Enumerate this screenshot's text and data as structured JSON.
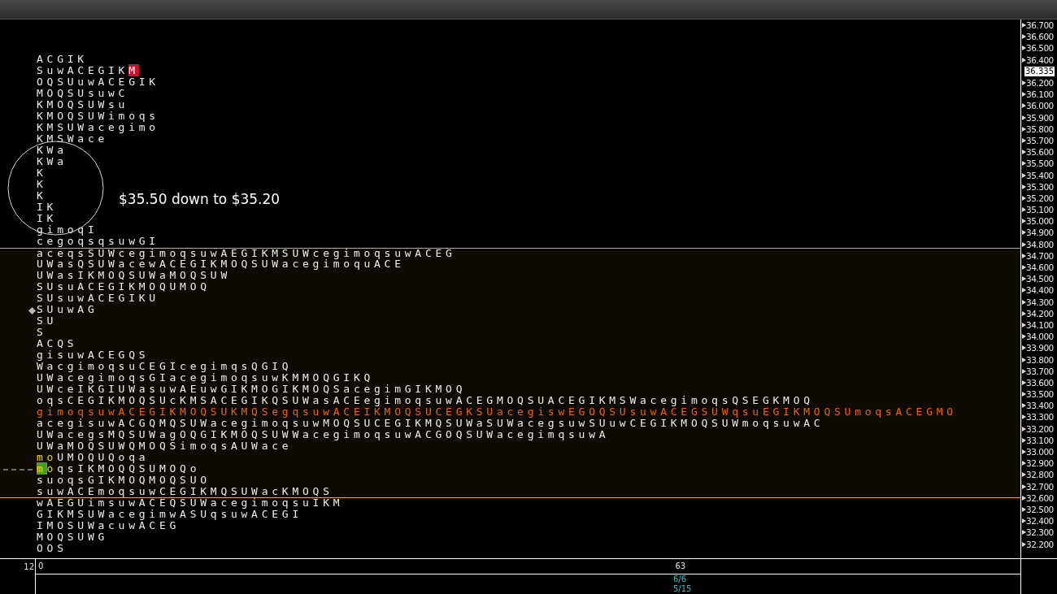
{
  "annotation": {
    "text": "$35.50 down to $35.20"
  },
  "rows": [
    {
      "in_value_area": false,
      "kind": "plain",
      "parts": [
        {
          "text": "ACGIK",
          "kind": "normal"
        }
      ]
    },
    {
      "in_value_area": false,
      "kind": "plain",
      "parts": [
        {
          "text": "SuwACEGIK",
          "kind": "normal"
        },
        {
          "text": "M",
          "kind": "red_box"
        }
      ]
    },
    {
      "in_value_area": false,
      "kind": "plain",
      "parts": [
        {
          "text": "OQSUuwACEGIK",
          "kind": "normal"
        }
      ]
    },
    {
      "in_value_area": false,
      "kind": "plain",
      "parts": [
        {
          "text": "MOQSUsuwC",
          "kind": "normal"
        }
      ]
    },
    {
      "in_value_area": false,
      "kind": "plain",
      "parts": [
        {
          "text": "KMOQSUWsu",
          "kind": "normal"
        }
      ]
    },
    {
      "in_value_area": false,
      "kind": "plain",
      "parts": [
        {
          "text": "KMOQSUWimoqs",
          "kind": "normal"
        }
      ]
    },
    {
      "in_value_area": false,
      "kind": "plain",
      "parts": [
        {
          "text": "KMSUWacegimo",
          "kind": "normal"
        }
      ]
    },
    {
      "in_value_area": false,
      "kind": "plain",
      "parts": [
        {
          "text": "KMSWace",
          "kind": "normal"
        }
      ]
    },
    {
      "in_value_area": false,
      "kind": "plain",
      "parts": [
        {
          "text": "KWa",
          "kind": "normal"
        }
      ]
    },
    {
      "in_value_area": false,
      "kind": "plain",
      "parts": [
        {
          "text": "KWa",
          "kind": "normal"
        }
      ]
    },
    {
      "in_value_area": false,
      "kind": "plain",
      "parts": [
        {
          "text": "K",
          "kind": "normal"
        }
      ]
    },
    {
      "in_value_area": false,
      "kind": "plain",
      "parts": [
        {
          "text": "K",
          "kind": "normal"
        }
      ]
    },
    {
      "in_value_area": false,
      "kind": "plain",
      "parts": [
        {
          "text": "K",
          "kind": "normal"
        }
      ]
    },
    {
      "in_value_area": false,
      "kind": "plain",
      "parts": [
        {
          "text": "IK",
          "kind": "normal"
        }
      ]
    },
    {
      "in_value_area": false,
      "kind": "plain",
      "parts": [
        {
          "text": "IK",
          "kind": "normal"
        }
      ]
    },
    {
      "in_value_area": false,
      "kind": "plain",
      "parts": [
        {
          "text": "gimoqI",
          "kind": "normal"
        }
      ]
    },
    {
      "in_value_area": false,
      "kind": "plain",
      "parts": [
        {
          "text": "cegoqsqsuwGI",
          "kind": "normal"
        }
      ]
    },
    {
      "in_value_area": true,
      "kind": "plain",
      "parts": [
        {
          "text": "aceqsSUWcegimoqsuwAEGIKMSUWcegimoqsuwACEG",
          "kind": "normal"
        }
      ]
    },
    {
      "in_value_area": true,
      "kind": "plain",
      "parts": [
        {
          "text": "UWasQSUWacewACEGIKMOQSUWacegimoquACE",
          "kind": "normal"
        }
      ]
    },
    {
      "in_value_area": true,
      "kind": "plain",
      "parts": [
        {
          "text": "UWasIKMOQSUWaMOQSUW",
          "kind": "normal"
        }
      ]
    },
    {
      "in_value_area": true,
      "kind": "plain",
      "parts": [
        {
          "text": "SUsuACEGIKMOQUMOQ",
          "kind": "normal"
        }
      ]
    },
    {
      "in_value_area": true,
      "kind": "plain",
      "parts": [
        {
          "text": "SUsuwACEGIKU",
          "kind": "normal"
        }
      ]
    },
    {
      "in_value_area": true,
      "kind": "diamond",
      "parts": [
        {
          "text": "SUuwAG",
          "kind": "normal"
        }
      ]
    },
    {
      "in_value_area": true,
      "kind": "plain",
      "parts": [
        {
          "text": "SU",
          "kind": "normal"
        }
      ]
    },
    {
      "in_value_area": true,
      "kind": "plain",
      "parts": [
        {
          "text": "S",
          "kind": "normal"
        }
      ]
    },
    {
      "in_value_area": true,
      "kind": "plain",
      "parts": [
        {
          "text": "ACQS",
          "kind": "normal"
        }
      ]
    },
    {
      "in_value_area": true,
      "kind": "plain",
      "parts": [
        {
          "text": "gisuwACEGQS",
          "kind": "normal"
        }
      ]
    },
    {
      "in_value_area": true,
      "kind": "plain",
      "parts": [
        {
          "text": "WacgimoqsuCEGIcegimqsQGIQ",
          "kind": "normal"
        }
      ]
    },
    {
      "in_value_area": true,
      "kind": "plain",
      "parts": [
        {
          "text": "UWacegimoqsGIacegimoqsuwKMMOQGIKQ",
          "kind": "normal"
        }
      ]
    },
    {
      "in_value_area": true,
      "kind": "plain",
      "parts": [
        {
          "text": "UWceIKGIUWasuwAEuwGIKMOGIKMOQSacegimGIKMOQ",
          "kind": "normal"
        }
      ]
    },
    {
      "in_value_area": true,
      "kind": "plain",
      "parts": [
        {
          "text": "oqsCEGIKMOQSUcKMSACEGIKQSUWasACEegimoqsuwACEGMOQSUACEGIKMSWacegimoqsQSEGKMOQ",
          "kind": "normal"
        }
      ]
    },
    {
      "in_value_area": true,
      "kind": "plain",
      "parts": [
        {
          "text": "gimoqsuwACEGIKMOQSUKMQSegqsuwACEIKMOQSUCEGKSUacegiswEGOQSUsuwACEGSUWqsuEGIKMOQSUmoqsACEGMO",
          "kind": "orange"
        }
      ]
    },
    {
      "in_value_area": true,
      "kind": "plain",
      "parts": [
        {
          "text": "acegisuwACGQMQSUWacegimoqsuwMOQSUCEGIKMQSUWaSUWacegsuwSUuwCEGIKMOQSUWmoqsuwAC",
          "kind": "normal"
        }
      ]
    },
    {
      "in_value_area": true,
      "kind": "plain",
      "parts": [
        {
          "text": "UWacegsMQSUWagOQGIKMOQSUWWacegimoqsuwACGOQSUWacegimqsuwA",
          "kind": "normal"
        }
      ]
    },
    {
      "in_value_area": true,
      "kind": "plain",
      "parts": [
        {
          "text": "UWaMOQSUWQMOQSimoqsAUWace",
          "kind": "normal"
        }
      ]
    },
    {
      "in_value_area": true,
      "kind": "plain",
      "parts": [
        {
          "text": "mo",
          "kind": "yellow"
        },
        {
          "text": "UMOQUQoqa",
          "kind": "normal"
        }
      ]
    },
    {
      "in_value_area": true,
      "kind": "dashed",
      "parts": [
        {
          "text": "m",
          "kind": "green_box"
        },
        {
          "text": "o",
          "kind": "yellow"
        },
        {
          "text": "qsIKMOQQSUMOQo",
          "kind": "normal"
        }
      ]
    },
    {
      "in_value_area": true,
      "kind": "plain",
      "parts": [
        {
          "text": "suoqsGIKMOQMOQSUO",
          "kind": "normal"
        }
      ]
    },
    {
      "in_value_area": true,
      "kind": "plain",
      "parts": [
        {
          "text": "suwACEmoqsuwCEGIKMQSUWacKMOQS",
          "kind": "normal"
        }
      ]
    },
    {
      "in_value_area": false,
      "kind": "plain",
      "parts": [
        {
          "text": "wAEGUimsuwACEQSUWacegimoqsuIKM",
          "kind": "normal"
        }
      ]
    },
    {
      "in_value_area": false,
      "kind": "plain",
      "parts": [
        {
          "text": "GIKMSUWacegimwASUqsuwACEGI",
          "kind": "normal"
        }
      ]
    },
    {
      "in_value_area": false,
      "kind": "plain",
      "parts": [
        {
          "text": "IMOSUWacuwACEG",
          "kind": "normal"
        }
      ]
    },
    {
      "in_value_area": false,
      "kind": "plain",
      "parts": [
        {
          "text": "MOQSUWG",
          "kind": "normal"
        }
      ]
    },
    {
      "in_value_area": false,
      "kind": "plain",
      "parts": [
        {
          "text": "OOS",
          "kind": "normal"
        }
      ]
    }
  ],
  "price_axis": [
    {
      "kind": "tick",
      "label": "36.700"
    },
    {
      "kind": "tick",
      "label": "36.600"
    },
    {
      "kind": "tick",
      "label": "36.500"
    },
    {
      "kind": "tick",
      "label": "36.400"
    },
    {
      "kind": "current",
      "label": "36.335"
    },
    {
      "kind": "tick",
      "label": "36.200"
    },
    {
      "kind": "tick",
      "label": "36.100"
    },
    {
      "kind": "tick",
      "label": "36.000"
    },
    {
      "kind": "tick",
      "label": "35.900"
    },
    {
      "kind": "tick",
      "label": "35.800"
    },
    {
      "kind": "tick",
      "label": "35.700"
    },
    {
      "kind": "tick",
      "label": "35.600"
    },
    {
      "kind": "tick",
      "label": "35.500"
    },
    {
      "kind": "tick",
      "label": "35.400"
    },
    {
      "kind": "tick",
      "label": "35.300"
    },
    {
      "kind": "tick",
      "label": "35.200"
    },
    {
      "kind": "tick",
      "label": "35.100"
    },
    {
      "kind": "tick",
      "label": "35.000"
    },
    {
      "kind": "tick",
      "label": "34.900"
    },
    {
      "kind": "tick",
      "label": "34.800"
    },
    {
      "kind": "tick",
      "label": "34.700"
    },
    {
      "kind": "tick",
      "label": "34.600"
    },
    {
      "kind": "tick",
      "label": "34.500"
    },
    {
      "kind": "tick",
      "label": "34.400"
    },
    {
      "kind": "tick",
      "label": "34.300"
    },
    {
      "kind": "tick",
      "label": "34.200"
    },
    {
      "kind": "tick",
      "label": "34.100"
    },
    {
      "kind": "tick",
      "label": "34.000"
    },
    {
      "kind": "tick",
      "label": "33.900"
    },
    {
      "kind": "tick",
      "label": "33.800"
    },
    {
      "kind": "tick",
      "label": "33.700"
    },
    {
      "kind": "tick",
      "label": "33.600"
    },
    {
      "kind": "tick",
      "label": "33.500"
    },
    {
      "kind": "tick",
      "label": "33.400"
    },
    {
      "kind": "tick",
      "label": "33.300"
    },
    {
      "kind": "tick",
      "label": "33.200"
    },
    {
      "kind": "tick",
      "label": "33.100"
    },
    {
      "kind": "tick",
      "label": "33.000"
    },
    {
      "kind": "tick",
      "label": "32.900"
    },
    {
      "kind": "tick",
      "label": "32.800"
    },
    {
      "kind": "tick",
      "label": "32.700"
    },
    {
      "kind": "tick",
      "label": "32.600"
    },
    {
      "kind": "tick",
      "label": "32.500"
    },
    {
      "kind": "tick",
      "label": "32.400"
    },
    {
      "kind": "tick",
      "label": "32.300"
    },
    {
      "kind": "tick",
      "label": "32.200"
    }
  ],
  "x_axis": {
    "left_labels": [
      "12",
      "0"
    ],
    "mid_label": "63",
    "dates": [
      "6/6",
      "5/15"
    ]
  }
}
